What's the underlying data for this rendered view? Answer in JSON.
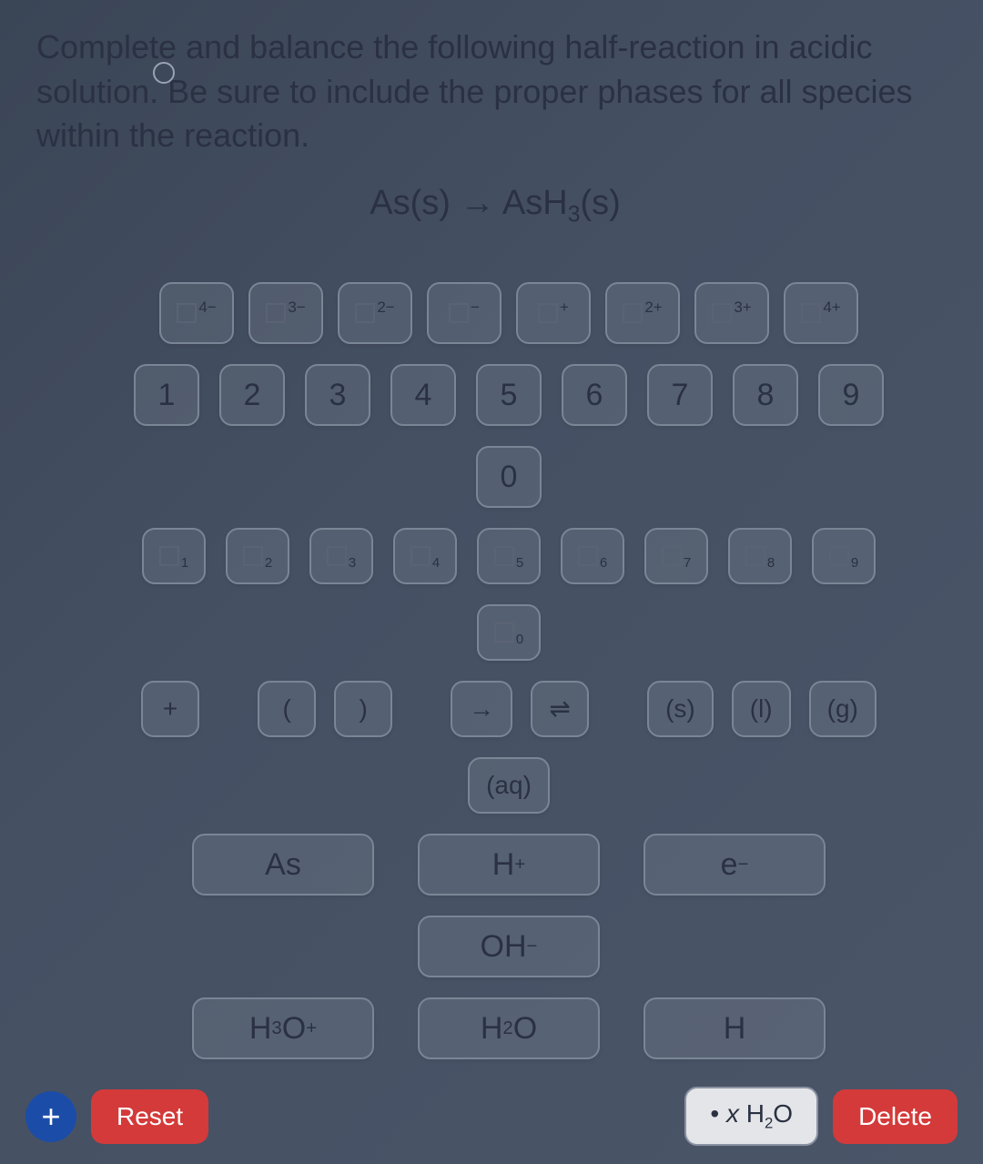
{
  "question": "Complete and balance the following half-reaction in acidic solution. Be sure to include the proper phases for all species within the reaction.",
  "equation": {
    "left_species": "As",
    "left_phase": "(s)",
    "arrow": "→",
    "right_species": "AsH",
    "right_sub": "3",
    "right_phase": "(s)"
  },
  "superscripts": [
    "4−",
    "3−",
    "2−",
    "−",
    "+",
    "2+",
    "3+",
    "4+"
  ],
  "numbers_row1": [
    "1",
    "2",
    "3",
    "4",
    "5",
    "6",
    "7",
    "8",
    "9"
  ],
  "zero": "0",
  "subscripts": [
    "1",
    "2",
    "3",
    "4",
    "5",
    "6",
    "7",
    "8",
    "9"
  ],
  "sub_zero": "0",
  "ops": {
    "plus": "+",
    "lparen": "(",
    "rparen": ")",
    "arrow": "→",
    "equil": "⇌",
    "s": "(s)",
    "l": "(l)",
    "g": "(g)",
    "aq": "(aq)"
  },
  "species": {
    "As": "As",
    "Hplus_base": "H",
    "Hplus_sup": "+",
    "eminus_base": "e",
    "eminus_sup": "−",
    "OH_base": "OH",
    "OH_sup": "−",
    "H3O_base1": "H",
    "H3O_sub1": "3",
    "H3O_base2": "O",
    "H3O_sup": "+",
    "H2O_base1": "H",
    "H2O_sub1": "2",
    "H2O_base2": "O",
    "H": "H"
  },
  "bottom": {
    "add": "+",
    "reset": "Reset",
    "hint_prefix": "• ",
    "hint_x": "x",
    "hint_h2o_h": " H",
    "hint_h2o_sub": "2",
    "hint_h2o_o": "O",
    "delete": "Delete"
  }
}
